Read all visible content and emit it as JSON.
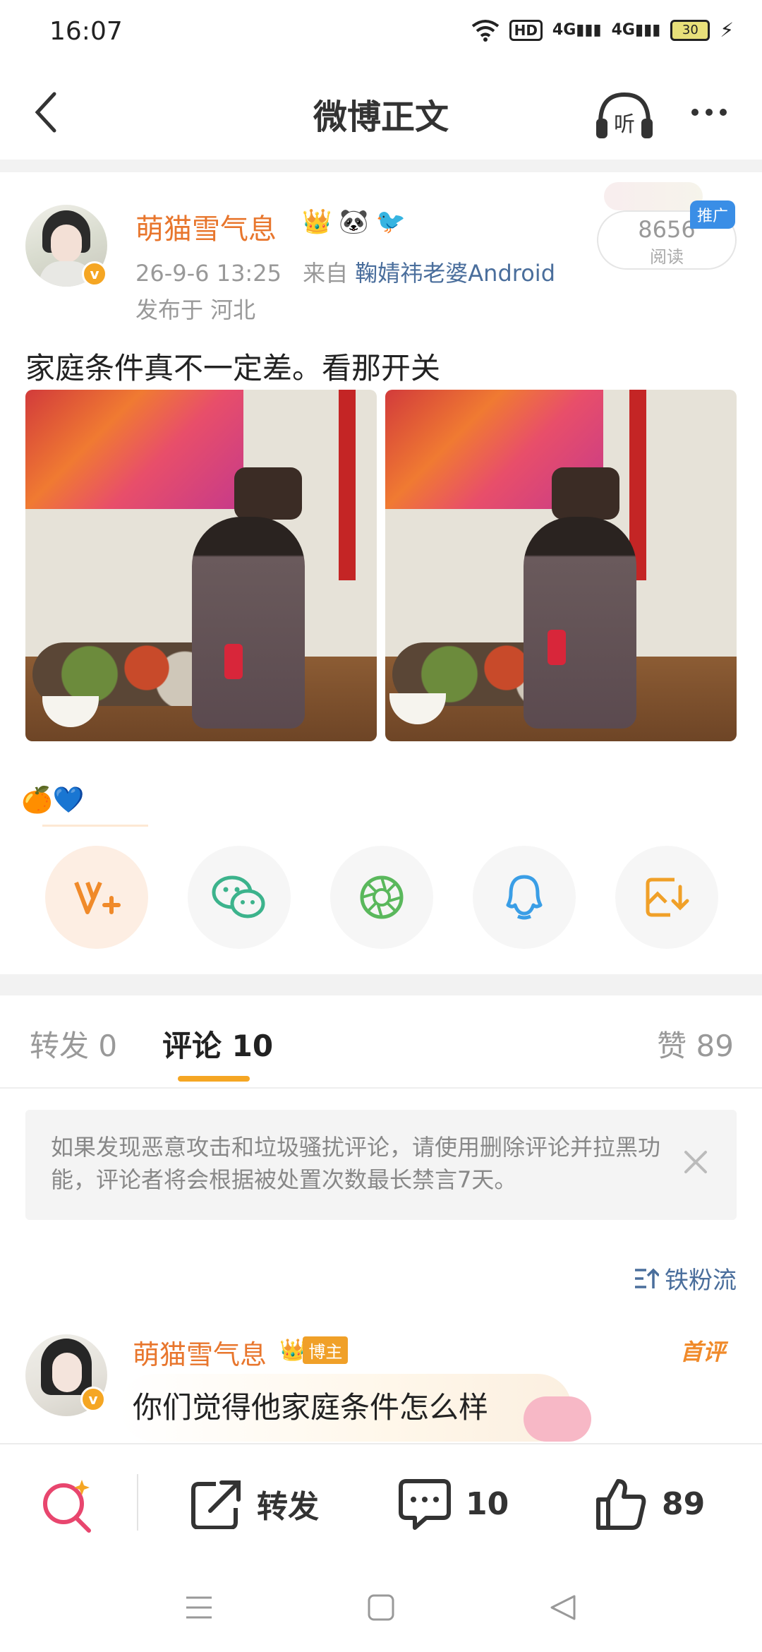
{
  "status_bar": {
    "time": "16:07",
    "hd": "HD",
    "signal_1": "4G",
    "signal_2": "4G",
    "battery": "30"
  },
  "header": {
    "title": "微博正文",
    "listen_label": "听"
  },
  "post": {
    "author": "萌猫雪气息",
    "verified_label": "v",
    "time": "26-9-6 13:25",
    "source_prefix": "来自",
    "source": "鞠婧祎老婆Android",
    "location": "发布于 河北",
    "read_count": "8656",
    "read_label": "阅读",
    "promo_tag": "推广",
    "text": "家庭条件真不一定差。看那开关",
    "emoji_row": "🍊💙",
    "name_icons": [
      "👑",
      "🐼",
      "🐦"
    ]
  },
  "share_icons": [
    "weibo-v-plus-icon",
    "wechat-icon",
    "moments-icon",
    "qq-icon",
    "save-image-icon"
  ],
  "tabs": {
    "repost_label": "转发",
    "repost_count": "0",
    "comment_label": "评论",
    "comment_count": "10",
    "like_label": "赞",
    "like_count": "89"
  },
  "notice": {
    "text": "如果发现恶意攻击和垃圾骚扰评论，请使用删除评论并拉黑功能，评论者将会根据被处置次数最长禁言7天。"
  },
  "sort": {
    "label": "铁粉流"
  },
  "comment": {
    "author": "萌猫雪气息",
    "badge": "博主",
    "first_tag": "首评",
    "verified_label": "v",
    "text": "你们觉得他家庭条件怎么样"
  },
  "bottom_bar": {
    "repost_label": "转发",
    "comment_count": "10",
    "like_count": "89"
  },
  "colors": {
    "accent_orange": "#f5a623",
    "username_orange": "#e8762d",
    "link_blue": "#4a6e9c",
    "promo_blue": "#3a8ee6"
  }
}
